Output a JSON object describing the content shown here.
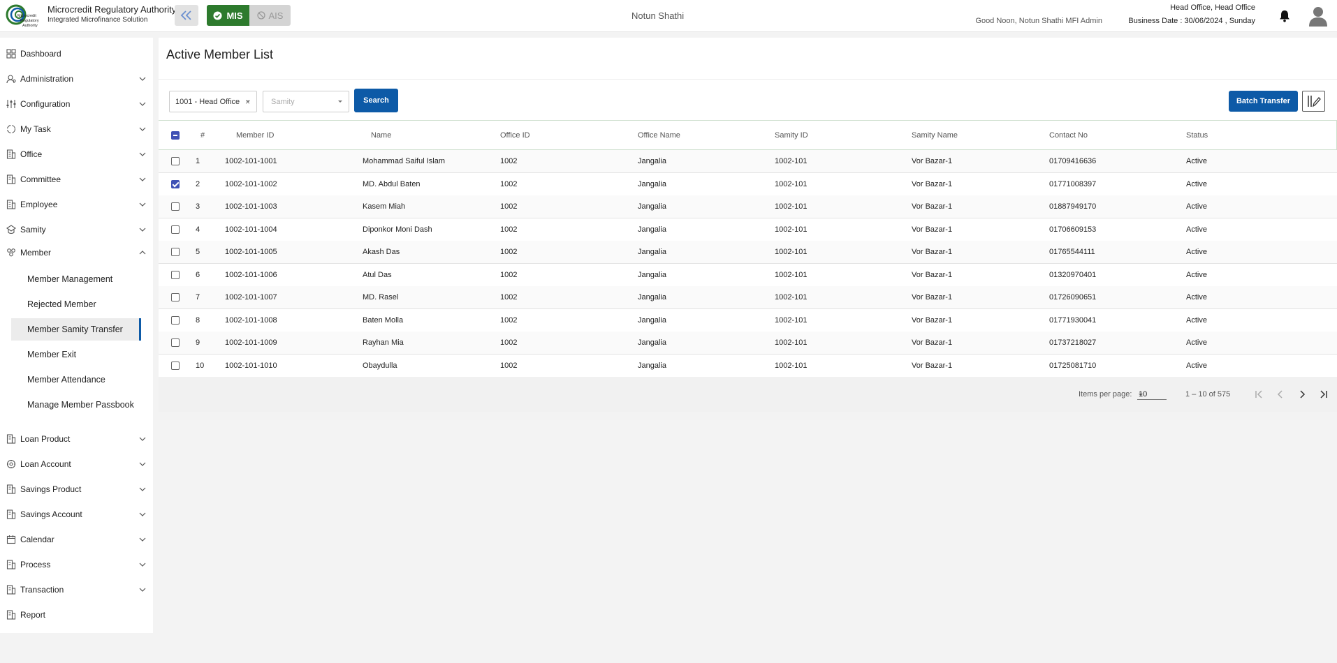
{
  "header": {
    "org_title": "Microcredit Regulatory Authority",
    "org_subtitle": "Integrated Microfinance Solution",
    "logo_text_1": "Microcredit",
    "logo_text_2": "Regulatory",
    "logo_text_3": "Authority",
    "mode_mis": "MIS",
    "mode_ais": "AIS",
    "app_name": "Notun Shathi",
    "greeting": "Good Noon, Notun Shathi MFI Admin",
    "office_line": "Head Office, Head Office",
    "business_date": "Business Date : 30/06/2024 , Sunday",
    "colors": {
      "mis_green": "#2d7a2d",
      "primary_blue": "#0d5aa7"
    }
  },
  "sidebar": {
    "items": [
      {
        "label": "Dashboard",
        "icon": "dashboard-icon",
        "expandable": false
      },
      {
        "label": "Administration",
        "icon": "admin-icon",
        "expandable": true
      },
      {
        "label": "Configuration",
        "icon": "sliders-icon",
        "expandable": true
      },
      {
        "label": "My Task",
        "icon": "task-icon",
        "expandable": true
      },
      {
        "label": "Office",
        "icon": "office-icon",
        "expandable": true
      },
      {
        "label": "Committee",
        "icon": "committee-icon",
        "expandable": true
      },
      {
        "label": "Employee",
        "icon": "employee-icon",
        "expandable": true
      },
      {
        "label": "Samity",
        "icon": "samity-icon",
        "expandable": true
      },
      {
        "label": "Member",
        "icon": "member-icon",
        "expandable": true,
        "expanded": true
      },
      {
        "label": "Loan Product",
        "icon": "loan-product-icon",
        "expandable": true
      },
      {
        "label": "Loan Account",
        "icon": "loan-account-icon",
        "expandable": true
      },
      {
        "label": "Savings Product",
        "icon": "savings-product-icon",
        "expandable": true
      },
      {
        "label": "Savings Account",
        "icon": "savings-account-icon",
        "expandable": true
      },
      {
        "label": "Calendar",
        "icon": "calendar-icon",
        "expandable": true
      },
      {
        "label": "Process",
        "icon": "process-icon",
        "expandable": true
      },
      {
        "label": "Transaction",
        "icon": "transaction-icon",
        "expandable": true
      },
      {
        "label": "Report",
        "icon": "report-icon",
        "expandable": false
      }
    ],
    "member_sub": [
      {
        "label": "Member Management"
      },
      {
        "label": "Rejected Member"
      },
      {
        "label": "Member Samity Transfer",
        "active": true
      },
      {
        "label": "Member Exit"
      },
      {
        "label": "Member Attendance"
      },
      {
        "label": "Manage Member Passbook"
      }
    ]
  },
  "main": {
    "title": "Active Member List",
    "office_select": "1001 - Head Office",
    "office_clear": "×",
    "samity_placeholder": "Samity",
    "search_label": "Search",
    "batch_transfer_label": "Batch Transfer",
    "table": {
      "headers": [
        "#",
        "Member ID",
        "Name",
        "Office ID",
        "Office Name",
        "Samity ID",
        "Samity Name",
        "Contact No",
        "Status"
      ],
      "rows": [
        {
          "n": "1",
          "member_id": "1002-101-1001",
          "name": "Mohammad Saiful Islam",
          "office_id": "1002",
          "office_name": "Jangalia",
          "samity_id": "1002-101",
          "samity_name": "Vor Bazar-1",
          "contact": "01709416636",
          "status": "Active",
          "checked": false
        },
        {
          "n": "2",
          "member_id": "1002-101-1002",
          "name": "MD. Abdul Baten",
          "office_id": "1002",
          "office_name": "Jangalia",
          "samity_id": "1002-101",
          "samity_name": "Vor Bazar-1",
          "contact": "01771008397",
          "status": "Active",
          "checked": true
        },
        {
          "n": "3",
          "member_id": "1002-101-1003",
          "name": "Kasem Miah",
          "office_id": "1002",
          "office_name": "Jangalia",
          "samity_id": "1002-101",
          "samity_name": "Vor Bazar-1",
          "contact": "01887949170",
          "status": "Active",
          "checked": false
        },
        {
          "n": "4",
          "member_id": "1002-101-1004",
          "name": "Diponkor Moni Dash",
          "office_id": "1002",
          "office_name": "Jangalia",
          "samity_id": "1002-101",
          "samity_name": "Vor Bazar-1",
          "contact": "01706609153",
          "status": "Active",
          "checked": false
        },
        {
          "n": "5",
          "member_id": "1002-101-1005",
          "name": "Akash Das",
          "office_id": "1002",
          "office_name": "Jangalia",
          "samity_id": "1002-101",
          "samity_name": "Vor Bazar-1",
          "contact": "01765544111",
          "status": "Active",
          "checked": false
        },
        {
          "n": "6",
          "member_id": "1002-101-1006",
          "name": "Atul Das",
          "office_id": "1002",
          "office_name": "Jangalia",
          "samity_id": "1002-101",
          "samity_name": "Vor Bazar-1",
          "contact": "01320970401",
          "status": "Active",
          "checked": false
        },
        {
          "n": "7",
          "member_id": "1002-101-1007",
          "name": "MD. Rasel",
          "office_id": "1002",
          "office_name": "Jangalia",
          "samity_id": "1002-101",
          "samity_name": "Vor Bazar-1",
          "contact": "01726090651",
          "status": "Active",
          "checked": false
        },
        {
          "n": "8",
          "member_id": "1002-101-1008",
          "name": "Baten Molla",
          "office_id": "1002",
          "office_name": "Jangalia",
          "samity_id": "1002-101",
          "samity_name": "Vor Bazar-1",
          "contact": "01771930041",
          "status": "Active",
          "checked": false
        },
        {
          "n": "9",
          "member_id": "1002-101-1009",
          "name": "Rayhan Mia",
          "office_id": "1002",
          "office_name": "Jangalia",
          "samity_id": "1002-101",
          "samity_name": "Vor Bazar-1",
          "contact": "01737218027",
          "status": "Active",
          "checked": false
        },
        {
          "n": "10",
          "member_id": "1002-101-1010",
          "name": "Obaydulla",
          "office_id": "1002",
          "office_name": "Jangalia",
          "samity_id": "1002-101",
          "samity_name": "Vor Bazar-1",
          "contact": "01725081710",
          "status": "Active",
          "checked": false
        }
      ]
    },
    "paginator": {
      "items_per_page_label": "Items per page:",
      "page_size": "10",
      "range": "1 – 10 of 575"
    }
  }
}
